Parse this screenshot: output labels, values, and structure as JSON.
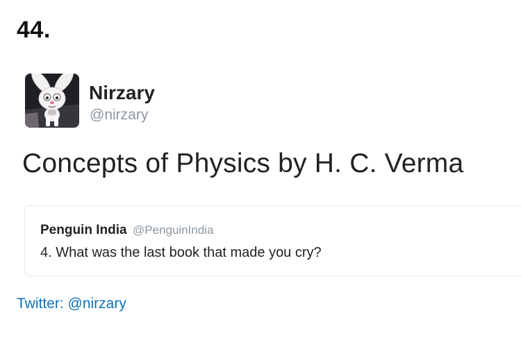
{
  "item": {
    "number": "44."
  },
  "tweet": {
    "avatar_icon": "rabbit-avatar-icon",
    "display_name": "Nirzary",
    "handle": "@nirzary",
    "text": "Concepts of Physics by H. C. Verma",
    "quoted_tweet": {
      "display_name": "Penguin India",
      "handle": "@PenguinIndia",
      "text": "4. What was the last book that made you cry?"
    }
  },
  "credit": {
    "text": "Twitter: @nirzary"
  },
  "colors": {
    "text": "#222222",
    "handle_gray": "#8b97a1",
    "link_blue": "#0f72b8",
    "quote_border": "#e1e8ed"
  }
}
